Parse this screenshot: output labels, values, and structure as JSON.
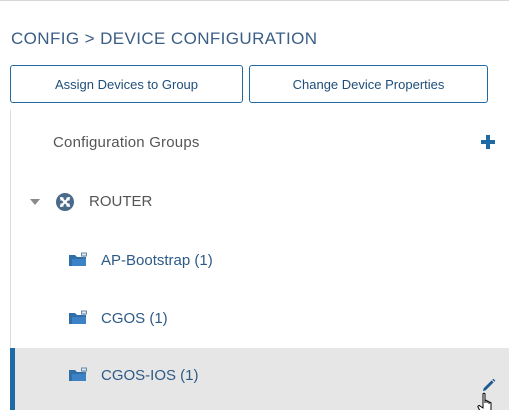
{
  "breadcrumb": "CONFIG > DEVICE CONFIGURATION",
  "toolbar": {
    "assign_label": "Assign Devices to Group",
    "change_label": "Change Device Properties"
  },
  "tree": {
    "header_title": "Configuration Groups",
    "add_icon": "plus-icon",
    "root": {
      "label": "ROUTER",
      "expanded": true,
      "icon": "router-icon"
    },
    "groups": [
      {
        "label": "AP-Bootstrap (1)",
        "icon": "folder-devices-icon",
        "selected": false
      },
      {
        "label": "CGOS (1)",
        "icon": "folder-devices-icon",
        "selected": false
      },
      {
        "label": "CGOS-IOS (1)",
        "icon": "folder-devices-icon",
        "selected": true
      }
    ]
  },
  "colors": {
    "accent": "#1e6aa5",
    "breadcrumb": "#3b5e86",
    "link": "#2d5a86",
    "selected_row": "#e6e6e6"
  }
}
